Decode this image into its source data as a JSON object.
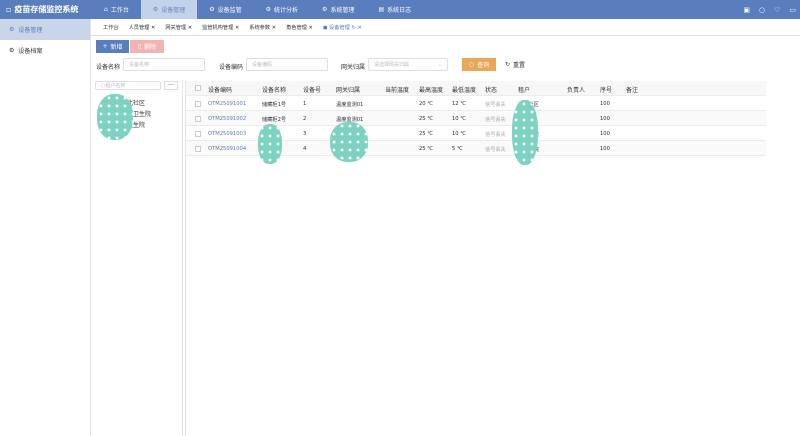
{
  "app": {
    "title": "疫苗存储监控系统"
  },
  "nav": [
    {
      "label": "工作台",
      "icon": "home-icon"
    },
    {
      "label": "设备管理",
      "icon": "gear-icon"
    },
    {
      "label": "设备监管",
      "icon": "gear-icon"
    },
    {
      "label": "统计分析",
      "icon": "gear-icon"
    },
    {
      "label": "系统管理",
      "icon": "gear-icon"
    },
    {
      "label": "系统日志",
      "icon": "doc-icon"
    }
  ],
  "sidebar": [
    {
      "label": "设备管理"
    },
    {
      "label": "设备档案"
    }
  ],
  "tabs": [
    "工作台",
    "人员管理",
    "网关管理",
    "监管机构管理",
    "系统参数",
    "角色管理",
    "设备管理"
  ],
  "toolbar": {
    "add": "新增",
    "delete": "删除"
  },
  "search": {
    "name_label": "设备名称",
    "name_ph": "设备名称",
    "code_label": "设备编码",
    "code_ph": "设备编码",
    "gw_label": "网关归属",
    "gw_ph": "请选择网关归属",
    "query": "查询",
    "reset": "重置"
  },
  "tree": {
    "search_ph": "租户名称",
    "more": "···",
    "items": [
      "北社区",
      "城卫生院",
      "卫生院"
    ]
  },
  "table": {
    "columns": [
      "设备编码",
      "设备名称",
      "设备号",
      "网关归属",
      "当前温度",
      "最高温度",
      "最低温度",
      "状态",
      "租户",
      "负责人",
      "序号",
      "备注"
    ],
    "rows": [
      [
        "OTM25091001",
        "储藏柜1号",
        "1",
        "温度监测01",
        "",
        "20 ℃",
        "12 ℃",
        "信号丢失",
        "城北社区",
        "",
        "100",
        ""
      ],
      [
        "OTM25091002",
        "储藏柜2号",
        "2",
        "温度监测01",
        "",
        "25 ℃",
        "10 ℃",
        "信号丢失",
        "北社区",
        "",
        "100",
        ""
      ],
      [
        "OTM25091003",
        "疾...",
        "3",
        "度...",
        "",
        "25 ℃",
        "10 ℃",
        "信号丢失",
        "城卫生院",
        "",
        "100",
        ""
      ],
      [
        "OTM25091004",
        "疾...",
        "4",
        "度...",
        "",
        "25 ℃",
        "5 ℃",
        "信号丢失",
        "镇卫生院",
        "",
        "100",
        ""
      ]
    ]
  }
}
